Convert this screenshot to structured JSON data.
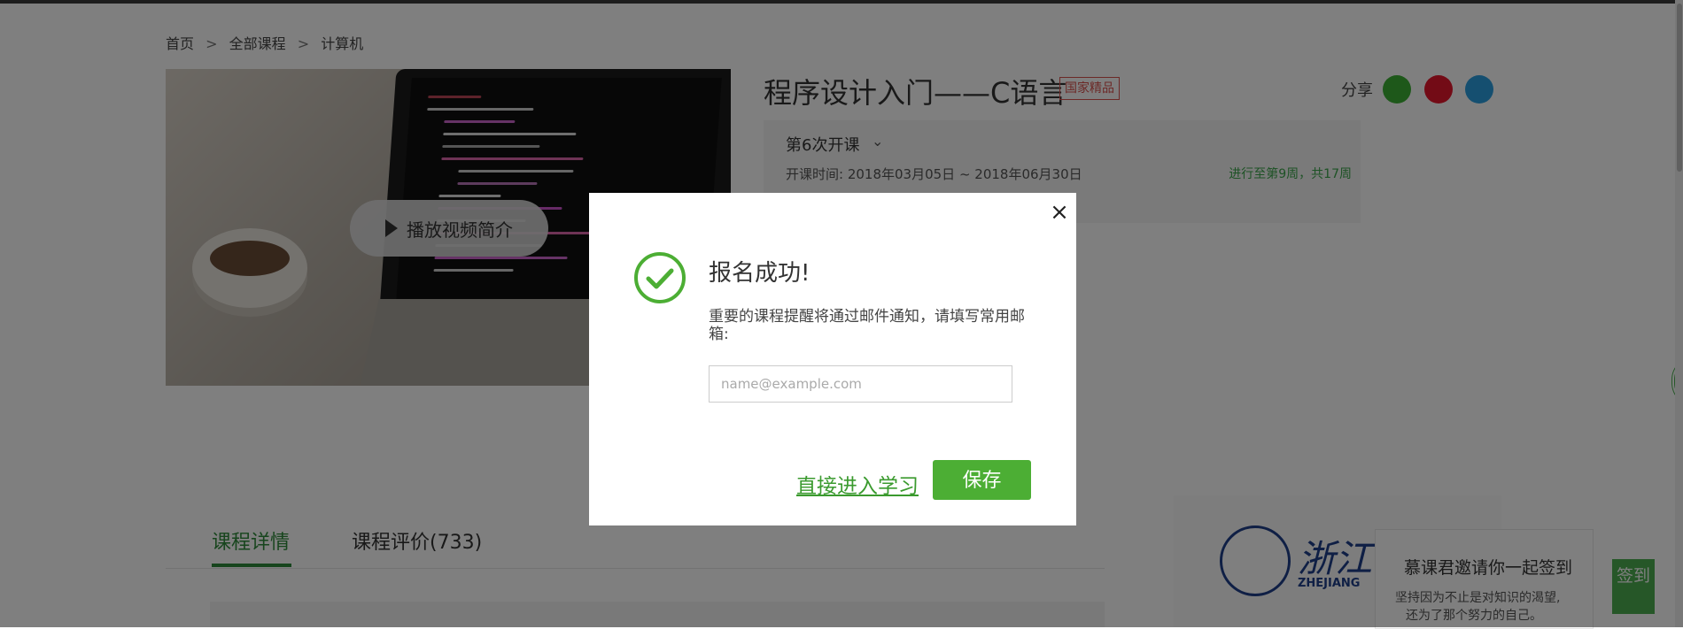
{
  "breadcrumb": {
    "home": "首页",
    "sep": ">",
    "all_courses": "全部课程",
    "category": "计算机"
  },
  "video": {
    "play_label": "播放视频简介"
  },
  "course": {
    "title": "程序设计入门——C语言",
    "badge": "国家精品",
    "share_label": "分享",
    "term_label": "第6次开课",
    "dates": "开课时间:  2018年03月05日 ~ 2018年06月30日",
    "progress": "进行至第9周，共17周"
  },
  "tabs": [
    {
      "label": "课程详情"
    },
    {
      "label": "课程评价(733)"
    }
  ],
  "university": {
    "name_cn": "浙江",
    "name_en": "ZHEJIANG"
  },
  "signin": {
    "title": "慕课君邀请你一起签到",
    "line1": "坚持因为不止是对知识的渴望,",
    "line2": "还为了那个努力的自己。",
    "button": "签到"
  },
  "modal": {
    "title": "报名成功!",
    "description": "重要的课程提醒将通过邮件通知，请填写常用邮箱:",
    "email_placeholder": "name@example.com",
    "email_value": "",
    "skip_label": "直接进入学习",
    "save_label": "保存",
    "close_icon": "×"
  },
  "colors": {
    "accent_green": "#4cae34",
    "badge_red": "#d9534f",
    "wechat": "#3cb034",
    "weibo": "#e6162d",
    "qq": "#2b9fe0"
  }
}
